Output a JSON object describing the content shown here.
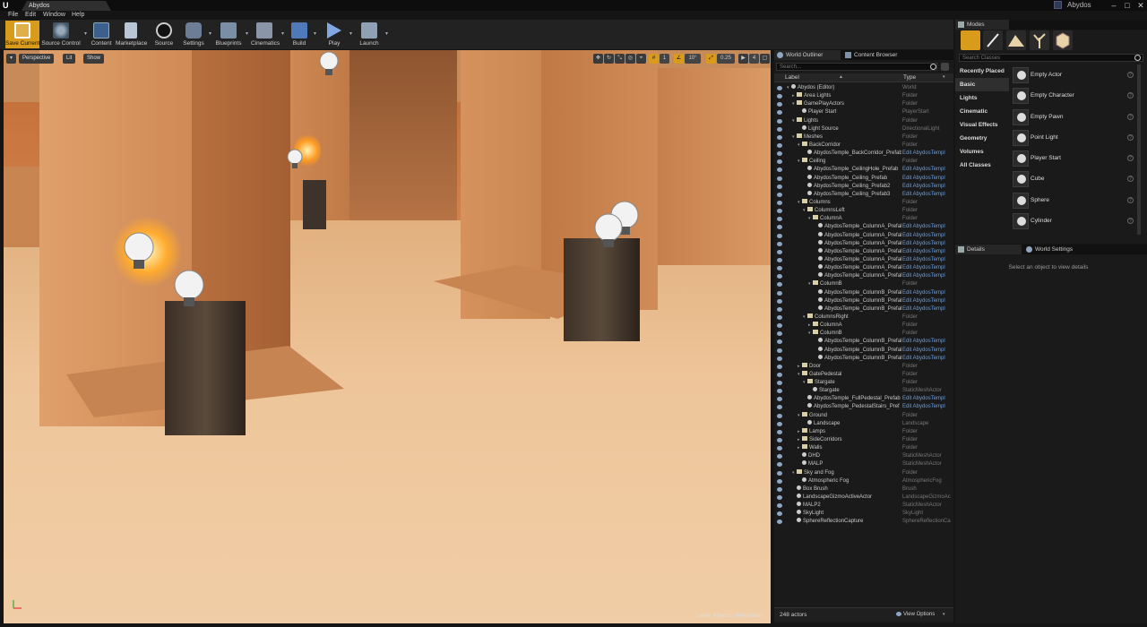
{
  "window": {
    "tab_title": "Abydos",
    "project_name": "Abydos",
    "win_buttons": [
      "–",
      "□",
      "✕"
    ]
  },
  "menu": [
    "File",
    "Edit",
    "Window",
    "Help"
  ],
  "toolbar": [
    {
      "label": "Save Current",
      "icon": "save-icon"
    },
    {
      "label": "Source Control",
      "icon": "source-control-icon"
    },
    {
      "label": "Content",
      "icon": "content-icon"
    },
    {
      "label": "Marketplace",
      "icon": "marketplace-icon"
    },
    {
      "label": "Source",
      "icon": "source-icon"
    },
    {
      "label": "Settings",
      "icon": "settings-icon"
    },
    {
      "label": "Blueprints",
      "icon": "blueprints-icon"
    },
    {
      "label": "Cinematics",
      "icon": "cinematics-icon"
    },
    {
      "label": "Build",
      "icon": "build-icon"
    },
    {
      "label": "Play",
      "icon": "play-icon"
    },
    {
      "label": "Launch",
      "icon": "launch-icon"
    }
  ],
  "viewport": {
    "perspective": "Perspective",
    "lit": "Lit",
    "show": "Show",
    "grid_snap": "10",
    "rot_snap": "10°",
    "scale_snap": "0.25",
    "cam_speed": "4",
    "grid_count": "1",
    "level_label": "Level:  Abydos (Persistent)"
  },
  "outliner": {
    "tabs": [
      "World Outliner",
      "Content Browser"
    ],
    "search_placeholder": "Search...",
    "col_label": "Label",
    "col_type": "Type",
    "rows": [
      {
        "d": 0,
        "n": "Abydos (Editor)",
        "t": "World",
        "k": "world",
        "x": "▾"
      },
      {
        "d": 1,
        "n": "Area Lights",
        "t": "Folder",
        "k": "folder",
        "x": "▸"
      },
      {
        "d": 1,
        "n": "GamePlayActors",
        "t": "Folder",
        "k": "folder",
        "x": "▾"
      },
      {
        "d": 2,
        "n": "Player Start",
        "t": "PlayerStart",
        "k": "actor",
        "x": ""
      },
      {
        "d": 1,
        "n": "Lights",
        "t": "Folder",
        "k": "folder",
        "x": "▾"
      },
      {
        "d": 2,
        "n": "Light Source",
        "t": "DirectionalLight",
        "k": "actor",
        "x": ""
      },
      {
        "d": 1,
        "n": "Meshes",
        "t": "Folder",
        "k": "folder",
        "x": "▾"
      },
      {
        "d": 2,
        "n": "BackCorridor",
        "t": "Folder",
        "k": "folder",
        "x": "▾"
      },
      {
        "d": 3,
        "n": "AbydosTemple_BackCorridor_Prefab",
        "t": "Edit AbydosTempl",
        "k": "actor",
        "x": "",
        "l": 1
      },
      {
        "d": 2,
        "n": "Ceiling",
        "t": "Folder",
        "k": "folder",
        "x": "▾"
      },
      {
        "d": 3,
        "n": "AbydosTemple_CeilingHole_Prefab",
        "t": "Edit AbydosTempl",
        "k": "actor",
        "x": "",
        "l": 1
      },
      {
        "d": 3,
        "n": "AbydosTemple_Ceiling_Prefab",
        "t": "Edit AbydosTempl",
        "k": "actor",
        "x": "",
        "l": 1
      },
      {
        "d": 3,
        "n": "AbydosTemple_Ceiling_Prefab2",
        "t": "Edit AbydosTempl",
        "k": "actor",
        "x": "",
        "l": 1
      },
      {
        "d": 3,
        "n": "AbydosTemple_Ceiling_Prefab3",
        "t": "Edit AbydosTempl",
        "k": "actor",
        "x": "",
        "l": 1
      },
      {
        "d": 2,
        "n": "Columns",
        "t": "Folder",
        "k": "folder",
        "x": "▾"
      },
      {
        "d": 3,
        "n": "ColumnsLeft",
        "t": "Folder",
        "k": "folder",
        "x": "▾"
      },
      {
        "d": 4,
        "n": "ColumnA",
        "t": "Folder",
        "k": "folder",
        "x": "▾"
      },
      {
        "d": 5,
        "n": "AbydosTemple_ColumnA_Prefab",
        "t": "Edit AbydosTempl",
        "k": "actor",
        "x": "",
        "l": 1
      },
      {
        "d": 5,
        "n": "AbydosTemple_ColumnA_Prefab",
        "t": "Edit AbydosTempl",
        "k": "actor",
        "x": "",
        "l": 1
      },
      {
        "d": 5,
        "n": "AbydosTemple_ColumnA_Prefab",
        "t": "Edit AbydosTempl",
        "k": "actor",
        "x": "",
        "l": 1
      },
      {
        "d": 5,
        "n": "AbydosTemple_ColumnA_Prefab",
        "t": "Edit AbydosTempl",
        "k": "actor",
        "x": "",
        "l": 1
      },
      {
        "d": 5,
        "n": "AbydosTemple_ColumnA_Prefab",
        "t": "Edit AbydosTempl",
        "k": "actor",
        "x": "",
        "l": 1
      },
      {
        "d": 5,
        "n": "AbydosTemple_ColumnA_Prefab",
        "t": "Edit AbydosTempl",
        "k": "actor",
        "x": "",
        "l": 1
      },
      {
        "d": 5,
        "n": "AbydosTemple_ColumnA_Prefab",
        "t": "Edit AbydosTempl",
        "k": "actor",
        "x": "",
        "l": 1
      },
      {
        "d": 4,
        "n": "ColumnB",
        "t": "Folder",
        "k": "folder",
        "x": "▾"
      },
      {
        "d": 5,
        "n": "AbydosTemple_ColumnB_Prefab",
        "t": "Edit AbydosTempl",
        "k": "actor",
        "x": "",
        "l": 1
      },
      {
        "d": 5,
        "n": "AbydosTemple_ColumnB_Prefab",
        "t": "Edit AbydosTempl",
        "k": "actor",
        "x": "",
        "l": 1
      },
      {
        "d": 5,
        "n": "AbydosTemple_ColumnB_Prefab",
        "t": "Edit AbydosTempl",
        "k": "actor",
        "x": "",
        "l": 1
      },
      {
        "d": 3,
        "n": "ColumnsRight",
        "t": "Folder",
        "k": "folder",
        "x": "▾"
      },
      {
        "d": 4,
        "n": "ColumnA",
        "t": "Folder",
        "k": "folder",
        "x": "▸"
      },
      {
        "d": 4,
        "n": "ColumnB",
        "t": "Folder",
        "k": "folder",
        "x": "▾"
      },
      {
        "d": 5,
        "n": "AbydosTemple_ColumnB_Prefab",
        "t": "Edit AbydosTempl",
        "k": "actor",
        "x": "",
        "l": 1
      },
      {
        "d": 5,
        "n": "AbydosTemple_ColumnB_Prefab",
        "t": "Edit AbydosTempl",
        "k": "actor",
        "x": "",
        "l": 1
      },
      {
        "d": 5,
        "n": "AbydosTemple_ColumnB_Prefab",
        "t": "Edit AbydosTempl",
        "k": "actor",
        "x": "",
        "l": 1
      },
      {
        "d": 2,
        "n": "Door",
        "t": "Folder",
        "k": "folder",
        "x": "▸"
      },
      {
        "d": 2,
        "n": "GatePedestal",
        "t": "Folder",
        "k": "folder",
        "x": "▾"
      },
      {
        "d": 3,
        "n": "Stargate",
        "t": "Folder",
        "k": "folder",
        "x": "▾"
      },
      {
        "d": 4,
        "n": "Stargate",
        "t": "StaticMeshActor",
        "k": "actor",
        "x": ""
      },
      {
        "d": 3,
        "n": "AbydosTemple_FullPedestal_Prefab",
        "t": "Edit AbydosTempl",
        "k": "actor",
        "x": "",
        "l": 1
      },
      {
        "d": 3,
        "n": "AbydosTemple_PedestalStairs_Pref",
        "t": "Edit AbydosTempl",
        "k": "actor",
        "x": "",
        "l": 1
      },
      {
        "d": 2,
        "n": "Ground",
        "t": "Folder",
        "k": "folder",
        "x": "▾"
      },
      {
        "d": 3,
        "n": "Landscape",
        "t": "Landscape",
        "k": "actor",
        "x": ""
      },
      {
        "d": 2,
        "n": "Lamps",
        "t": "Folder",
        "k": "folder",
        "x": "▸"
      },
      {
        "d": 2,
        "n": "SideCorridors",
        "t": "Folder",
        "k": "folder",
        "x": "▸"
      },
      {
        "d": 2,
        "n": "Walls",
        "t": "Folder",
        "k": "folder",
        "x": "▸"
      },
      {
        "d": 2,
        "n": "DHD",
        "t": "StaticMeshActor",
        "k": "actor",
        "x": ""
      },
      {
        "d": 2,
        "n": "MALP",
        "t": "StaticMeshActor",
        "k": "actor",
        "x": ""
      },
      {
        "d": 1,
        "n": "Sky and Fog",
        "t": "Folder",
        "k": "folder",
        "x": "▾"
      },
      {
        "d": 2,
        "n": "Atmospheric Fog",
        "t": "AtmosphericFog",
        "k": "actor",
        "x": ""
      },
      {
        "d": 1,
        "n": "Box Brush",
        "t": "Brush",
        "k": "actor",
        "x": ""
      },
      {
        "d": 1,
        "n": "LandscapeGizmoActiveActor",
        "t": "LandscapeGizmoAc",
        "k": "actor",
        "x": ""
      },
      {
        "d": 1,
        "n": "MALP2",
        "t": "StaticMeshActor",
        "k": "actor",
        "x": ""
      },
      {
        "d": 1,
        "n": "SkyLight",
        "t": "SkyLight",
        "k": "actor",
        "x": ""
      },
      {
        "d": 1,
        "n": "SphereReflectionCapture",
        "t": "SphereReflectionCa",
        "k": "actor",
        "x": ""
      }
    ],
    "actor_count": "248 actors",
    "view_options": "View Options"
  },
  "modes": {
    "tab": "Modes",
    "search_placeholder": "Search Classes",
    "categories": [
      "Recently Placed",
      "Basic",
      "Lights",
      "Cinematic",
      "Visual Effects",
      "Geometry",
      "Volumes",
      "All Classes"
    ],
    "active_category": "Basic",
    "items": [
      "Empty Actor",
      "Empty Character",
      "Empty Pawn",
      "Point Light",
      "Player Start",
      "Cube",
      "Sphere",
      "Cylinder"
    ]
  },
  "details": {
    "tabs": [
      "Details",
      "World Settings"
    ],
    "empty_message": "Select an object to view details"
  },
  "colors": {
    "accent": "#d99b1c",
    "link": "#6a9de0"
  }
}
